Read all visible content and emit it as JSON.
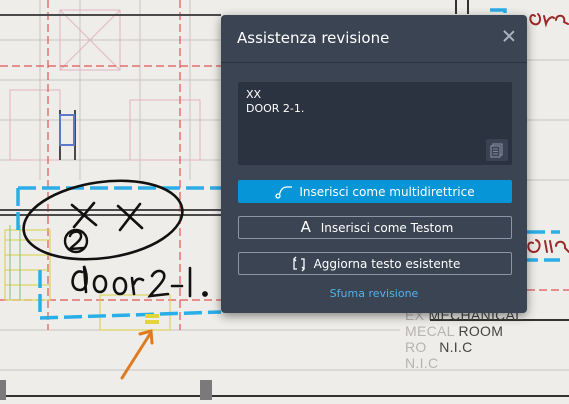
{
  "panel": {
    "title": "Assistenza revisione",
    "close_icon": "close-icon",
    "recognized_text": {
      "line1": "XX",
      "line2": "DOOR 2-1."
    },
    "copy_icon": "copy-icon",
    "buttons": {
      "insert_multileader": "Inserisci come multidirettrice",
      "insert_mtext": "Inserisci come Testom",
      "update_text": "Aggiorna testo esistente"
    },
    "dismiss_link": "Sfuma revisione",
    "colors": {
      "panel_bg": "#3b4453",
      "primary": "#0696d7",
      "link": "#4fb3ef"
    }
  },
  "drawing": {
    "room_label": {
      "line1": "MECHANICAL",
      "line2": "ROOM",
      "line3": "N.I.C",
      "ghost1": "EX",
      "ghost2": "ME",
      "ghost3": "CAL",
      "ghost4": "RO",
      "ghost5": "N.I.C"
    },
    "markup": {
      "handwriting": "door 2-1.",
      "annotation_color": "#2aaee8",
      "arrow_color": "#e07a20"
    }
  }
}
